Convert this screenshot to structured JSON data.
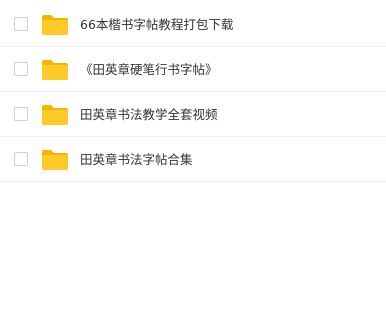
{
  "files": [
    {
      "name": "66本楷书字帖教程打包下载",
      "icon": "folder-icon"
    },
    {
      "name": "《田英章硬笔行书字帖》",
      "icon": "folder-icon"
    },
    {
      "name": "田英章书法教学全套视频",
      "icon": "folder-icon"
    },
    {
      "name": "田英章书法字帖合集",
      "icon": "folder-icon"
    }
  ],
  "colors": {
    "folder_body": "#ffca28",
    "folder_tab": "#f5b400",
    "text": "#333333",
    "divider": "#f2f2f2"
  }
}
